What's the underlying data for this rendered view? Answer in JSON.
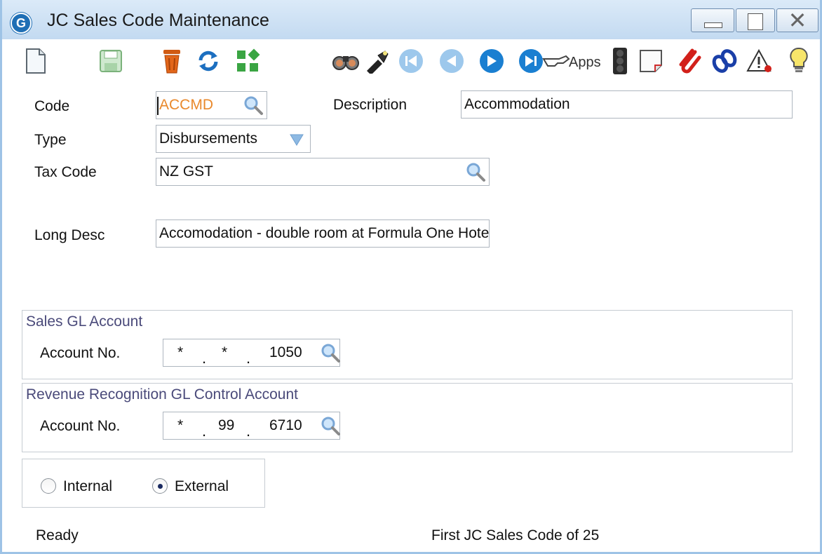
{
  "window": {
    "title": "JC Sales Code Maintenance",
    "app_icon_letter": "G"
  },
  "toolbar": {
    "icons": [
      "new-document-icon",
      "save-icon",
      "delete-icon",
      "refresh-icon",
      "grid-icon",
      "binoculars-icon",
      "flashlight-icon",
      "first-record-icon",
      "previous-record-icon",
      "next-record-icon",
      "last-record-icon",
      "apps-hand-icon",
      "traffic-light-icon",
      "note-icon",
      "attachment-icon",
      "link-icon",
      "warning-icon",
      "hint-bulb-icon"
    ],
    "apps_label": "Apps"
  },
  "form": {
    "code_label": "Code",
    "code_value": "ACCMD",
    "description_label": "Description",
    "description_value": "Accommodation",
    "type_label": "Type",
    "type_value": "Disbursements",
    "tax_code_label": "Tax Code",
    "tax_code_value": "NZ GST",
    "long_desc_label": "Long Desc",
    "long_desc_value": "Accomodation - double room at Formula One Hote"
  },
  "sales_gl": {
    "title": "Sales GL Account",
    "account_label": "Account No.",
    "seg1": "*",
    "seg2": "*",
    "seg3": "1050"
  },
  "revenue_gl": {
    "title": "Revenue Recognition GL Control Account",
    "account_label": "Account No.",
    "seg1": "*",
    "seg2": "99",
    "seg3": "6710"
  },
  "radio": {
    "internal_label": "Internal",
    "external_label": "External",
    "selected": "External"
  },
  "status": {
    "left": "Ready",
    "right": "First JC Sales Code of 25"
  },
  "colors": {
    "titlebar": "#c3daf1",
    "code_text": "#e9892c",
    "group_title": "#4a4a7a"
  }
}
